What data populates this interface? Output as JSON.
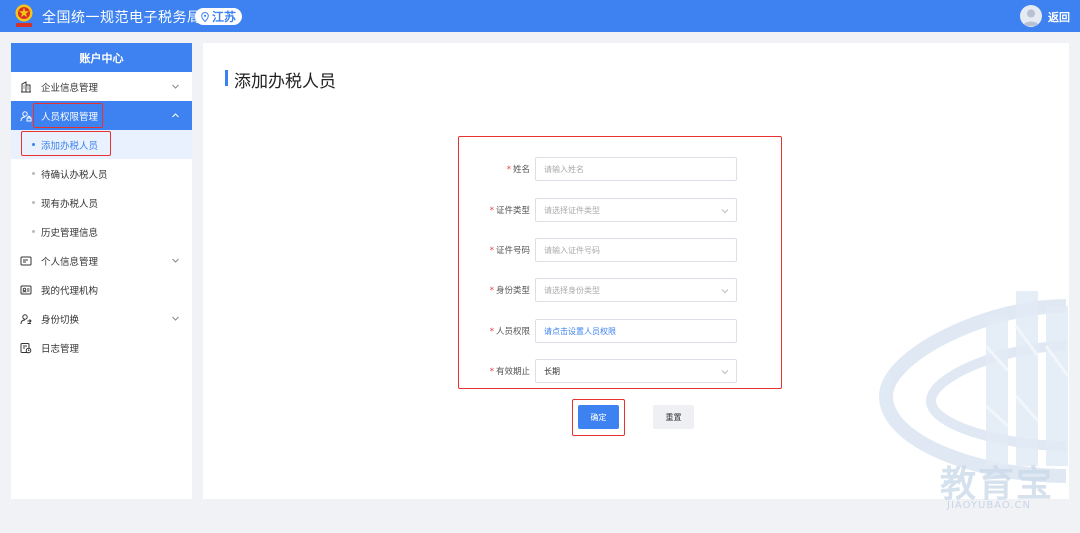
{
  "header": {
    "title": "全国统一规范电子税务局",
    "region": "江苏",
    "back": "返回"
  },
  "sidebar": {
    "title": "账户中心",
    "items": [
      {
        "label": "企业信息管理",
        "icon": "building-icon"
      },
      {
        "label": "人员权限管理",
        "icon": "user-lock-icon"
      },
      {
        "label": "个人信息管理",
        "icon": "id-card-icon"
      },
      {
        "label": "我的代理机构",
        "icon": "agency-icon"
      },
      {
        "label": "身份切换",
        "icon": "switch-icon"
      },
      {
        "label": "日志管理",
        "icon": "log-icon"
      }
    ],
    "sub_items": [
      "添加办税人员",
      "待确认办税人员",
      "现有办税人员",
      "历史管理信息"
    ]
  },
  "main": {
    "page_title": "添加办税人员",
    "form": {
      "name": {
        "label": "姓名",
        "placeholder": "请输入姓名"
      },
      "id_type": {
        "label": "证件类型",
        "placeholder": "请选择证件类型"
      },
      "id_number": {
        "label": "证件号码",
        "placeholder": "请输入证件号码"
      },
      "identity_type": {
        "label": "身份类型",
        "placeholder": "请选择身份类型"
      },
      "permission": {
        "label": "人员权限",
        "value": "请点击设置人员权限"
      },
      "expiry": {
        "label": "有效期止",
        "value": "长期"
      }
    },
    "confirm_label": "确定",
    "reset_label": "重置",
    "required_mark": "*"
  },
  "watermark": {
    "brand": "教育宝",
    "domain": "JIAOYUBAO.CN"
  },
  "colors": {
    "primary": "#3d82f0",
    "highlight": "#e8322d",
    "required": "#f04040"
  }
}
